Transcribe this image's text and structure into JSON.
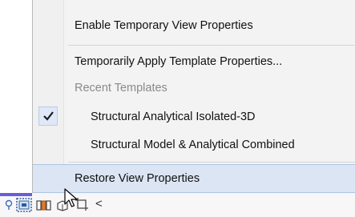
{
  "menu": {
    "items": [
      {
        "label": "Enable Temporary View Properties"
      },
      {
        "label": "Temporarily Apply Template Properties..."
      },
      {
        "label": "Recent Templates"
      },
      {
        "label": "Structural Analytical Isolated-3D",
        "checked": true
      },
      {
        "label": "Structural Model & Analytical Combined"
      },
      {
        "label": "Restore View Properties"
      }
    ]
  },
  "statusbar": {
    "icons": [
      "lightbulb-icon",
      "temporary-view-properties-icon",
      "reveal-hidden-elements-icon",
      "3d-view-lock-icon",
      "crop-region-icon",
      "collapse-arrow-icon"
    ],
    "collapse_glyph": "<"
  },
  "colors": {
    "hover_bg": "#dbe5f4",
    "accent": "#6a5cd6",
    "check_bg": "#dfe8f6"
  }
}
